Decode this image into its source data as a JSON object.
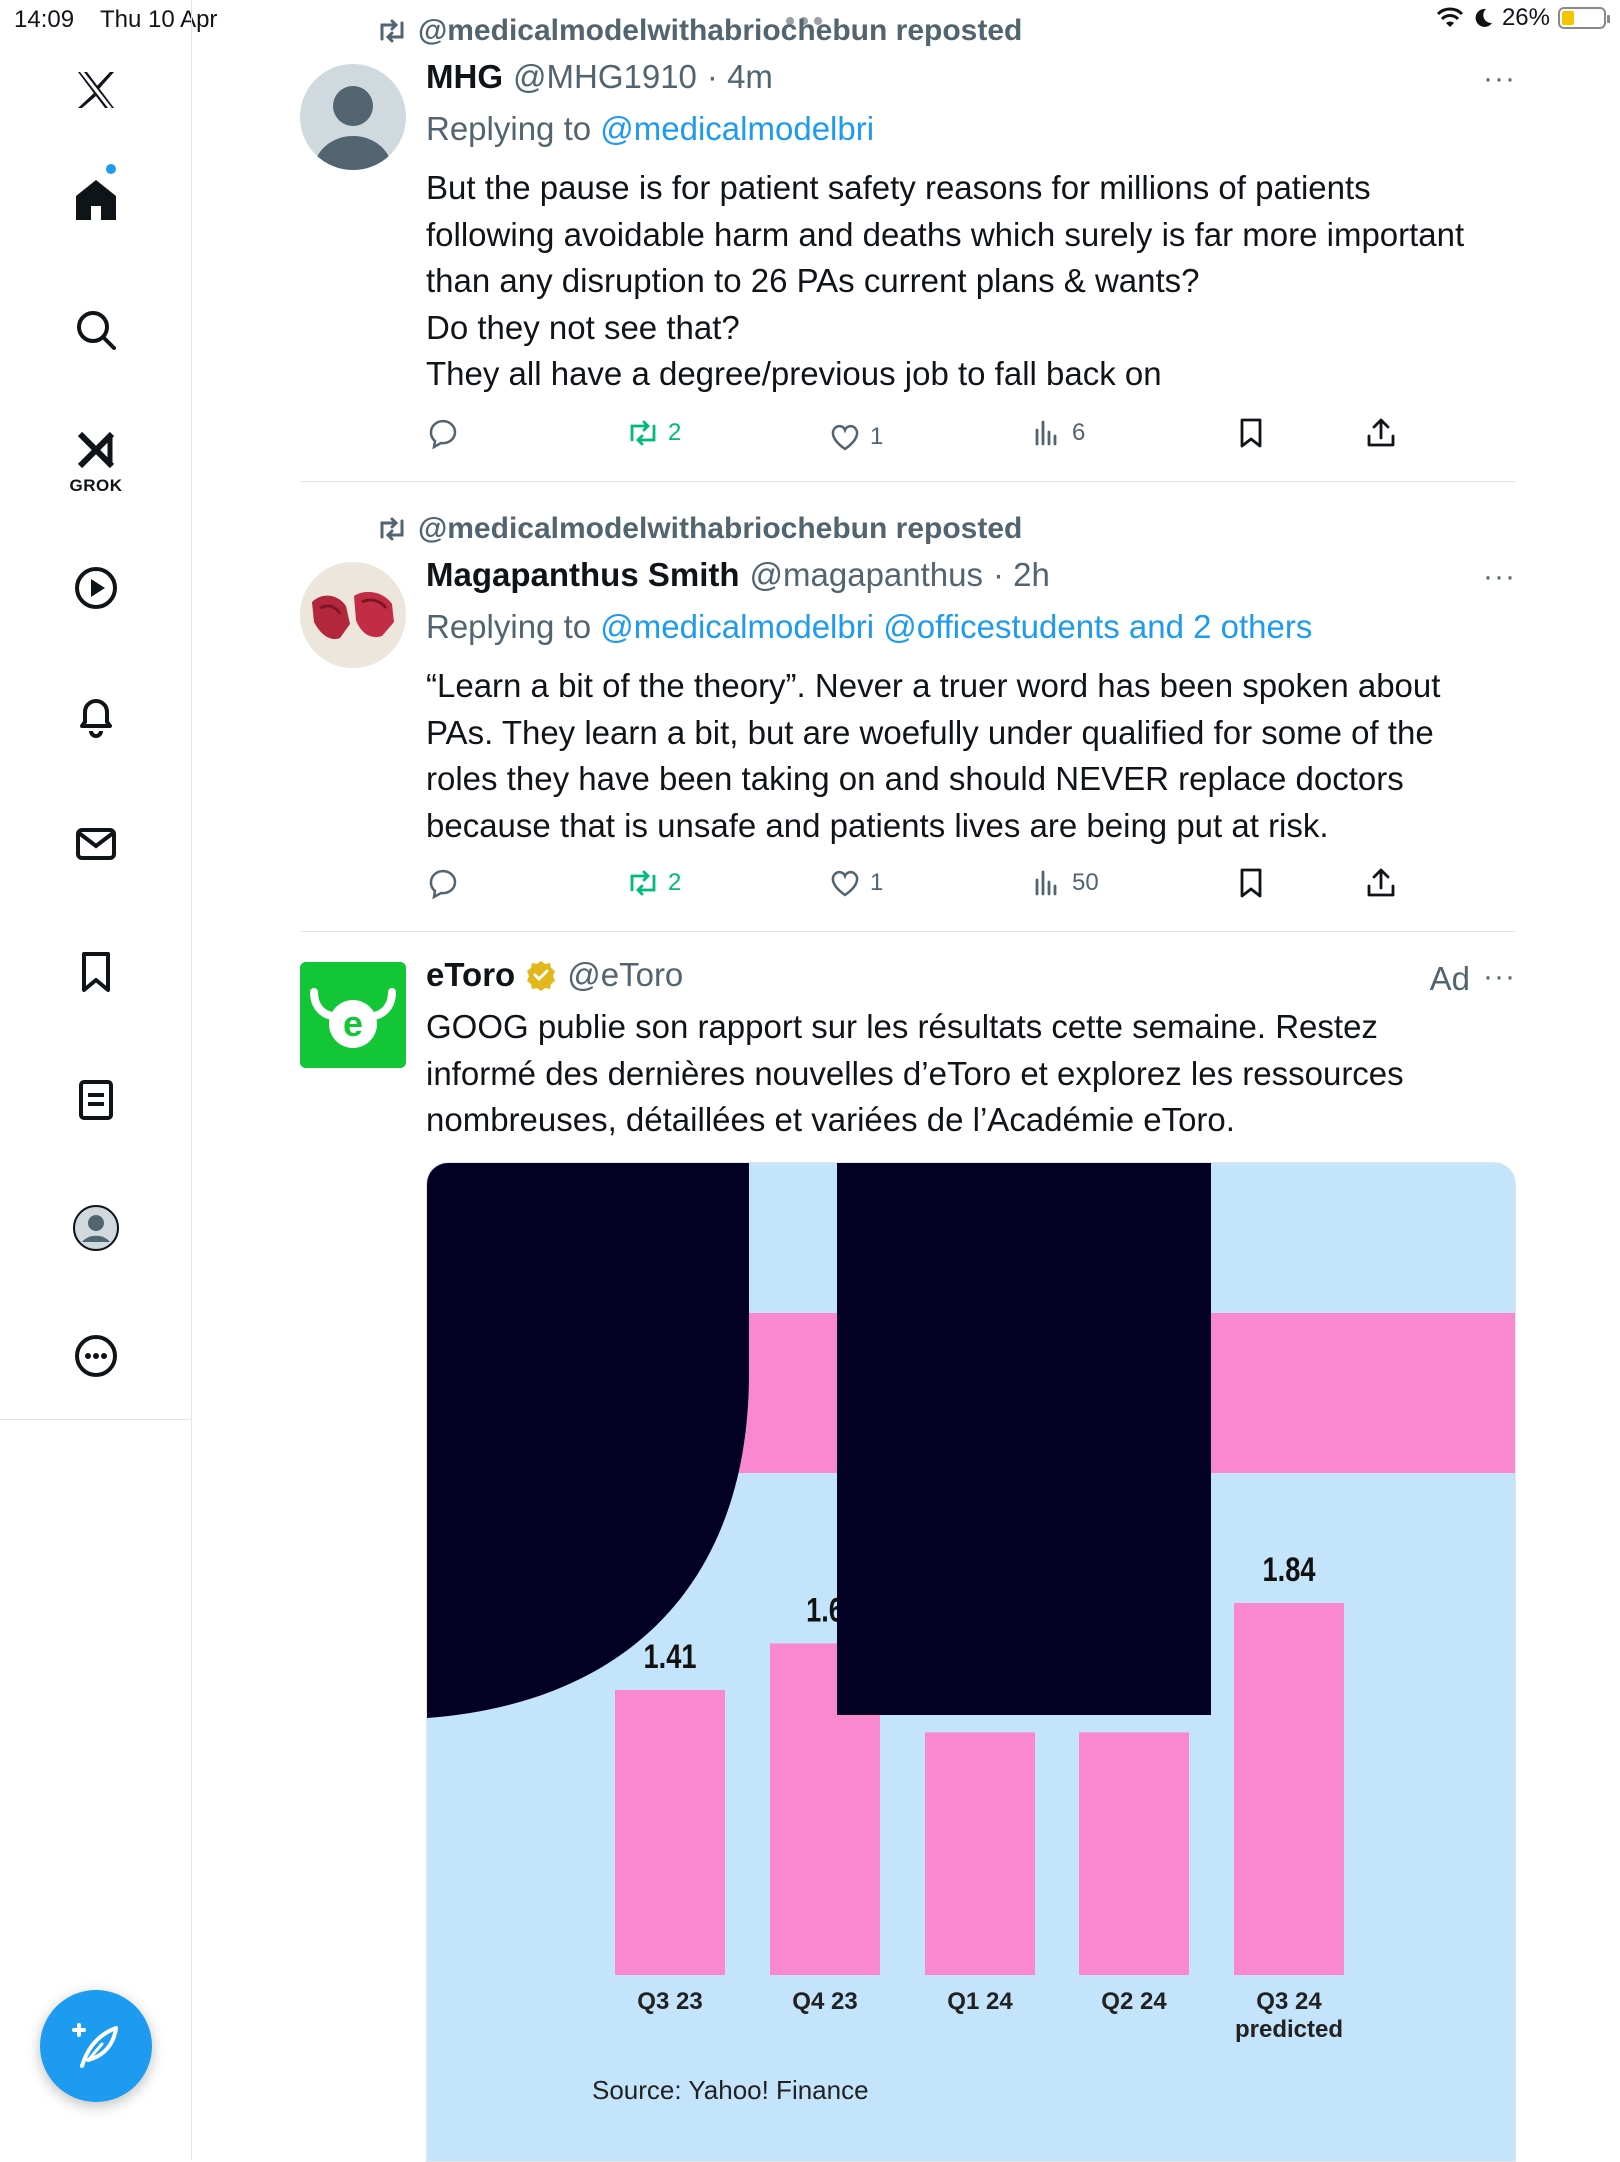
{
  "status_bar": {
    "time": "14:09",
    "date": "Thu 10 Apr",
    "battery": "26%"
  },
  "sidebar": {
    "items": [
      {
        "icon": "x-logo-icon"
      },
      {
        "icon": "home-icon",
        "has_notification": true
      },
      {
        "icon": "search-icon"
      },
      {
        "icon": "grok-icon",
        "label": "GROK"
      },
      {
        "icon": "play-icon"
      },
      {
        "icon": "bell-icon"
      },
      {
        "icon": "mail-icon"
      },
      {
        "icon": "bookmark-icon"
      },
      {
        "icon": "list-icon"
      },
      {
        "icon": "profile-avatar-icon"
      },
      {
        "icon": "more-circle-icon"
      }
    ],
    "compose_icon": "compose-feather-icon"
  },
  "posts": [
    {
      "repost_text": "@medicalmodelwithabriochebun reposted",
      "name": "MHG",
      "handle": "@MHG1910",
      "time": "· 4m",
      "replying_prefix": "Replying to",
      "replying_links": "@medicalmodelbri",
      "body": "But the pause is for patient safety reasons for millions of patients\nfollowing avoidable harm and deaths which surely is far more important\nthan any disruption to 26 PAs current plans & wants?\nDo they not see that?\nThey all have a degree/previous job to fall back on",
      "reposts": "2",
      "likes": "1",
      "views": "6",
      "more": "···"
    },
    {
      "repost_text": "@medicalmodelwithabriochebun reposted",
      "name": "Magapanthus Smith",
      "handle": "@magapanthus",
      "time": "· 2h",
      "replying_prefix": "Replying to",
      "replying_links": "@medicalmodelbri @officestudents and 2 others",
      "body": "“Learn a bit of the theory”. Never a truer word has been spoken about\nPAs. They learn a bit, but are woefully under qualified for some  of the\nroles  they have been taking on and should NEVER replace doctors\nbecause that is unsafe and patients lives are being put at risk.",
      "reposts": "2",
      "likes": "1",
      "views": "50",
      "more": "···"
    }
  ],
  "ad": {
    "name": "eToro",
    "handle": "@eToro",
    "ad_label": "Ad",
    "more": "···",
    "body": "GOOG publie son rapport sur les résultats cette semaine. Restez\ninformé des dernières nouvelles d’eToro et explorez les ressources\nnombreuses, détaillées et variées de l’Académie eToro.",
    "colors": {
      "brand": "#13c636",
      "chart_bg": "#c3e4fb",
      "bar": "#fa88cf",
      "redaction": "#020123"
    }
  },
  "chart_data": {
    "type": "bar",
    "categories": [
      "Q3 23",
      "Q4 23",
      "Q1 24",
      "Q2 24",
      "Q3 24 predicted"
    ],
    "category_lines": [
      [
        "Q3 23"
      ],
      [
        "Q4 23"
      ],
      [
        "Q1 24"
      ],
      [
        "Q2 24"
      ],
      [
        "Q3 24",
        "predicted"
      ]
    ],
    "values": [
      1.41,
      1.64,
      1.2,
      1.2,
      1.84
    ],
    "value_labels": [
      "1.41",
      "1.6",
      "",
      "",
      "1.84"
    ],
    "title": "",
    "xlabel": "",
    "ylabel": "",
    "source": "Source: Yahoo! Finance",
    "ylim": [
      0,
      1.84
    ]
  }
}
